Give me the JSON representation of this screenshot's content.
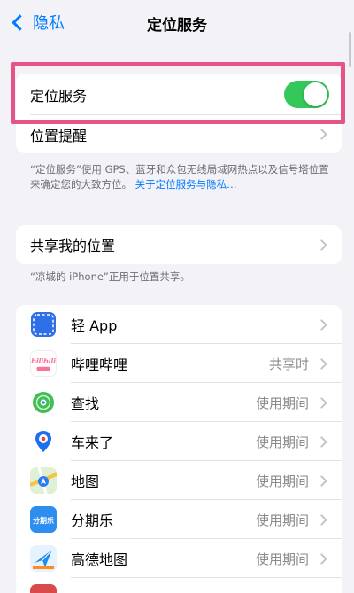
{
  "nav": {
    "back_label": "隐私",
    "title": "定位服务"
  },
  "location_services": {
    "label": "定位服务",
    "toggle_on": true
  },
  "location_alerts": {
    "label": "位置提醒"
  },
  "footnote1": {
    "text": "“定位服务”使用 GPS、蓝牙和众包无线局域网热点以及信号塔位置来确定您的大致方位。",
    "link": "关于定位服务与隐私…"
  },
  "share_location": {
    "label": "共享我的位置"
  },
  "footnote2": {
    "text": "“凉城的 iPhone”正用于位置共享。"
  },
  "apps": [
    {
      "name": "轻 App",
      "status": "",
      "icon": "light-app-icon"
    },
    {
      "name": "哔哩哔哩",
      "status": "共享时",
      "icon": "bilibili-icon"
    },
    {
      "name": "查找",
      "status": "使用期间",
      "icon": "find-my-icon"
    },
    {
      "name": "车来了",
      "status": "使用期间",
      "icon": "chelaile-icon"
    },
    {
      "name": "地图",
      "status": "使用期间",
      "icon": "maps-icon"
    },
    {
      "name": "分期乐",
      "status": "使用期间",
      "icon": "fenqile-icon"
    },
    {
      "name": "高德地图",
      "status": "使用期间",
      "icon": "amap-icon"
    }
  ],
  "colors": {
    "accent": "#007aff",
    "toggle_on": "#34c759",
    "highlight": "#e55487"
  },
  "icon_texts": {
    "bilibili_logo": "bilibili",
    "fenqile_logo": "分期乐"
  }
}
